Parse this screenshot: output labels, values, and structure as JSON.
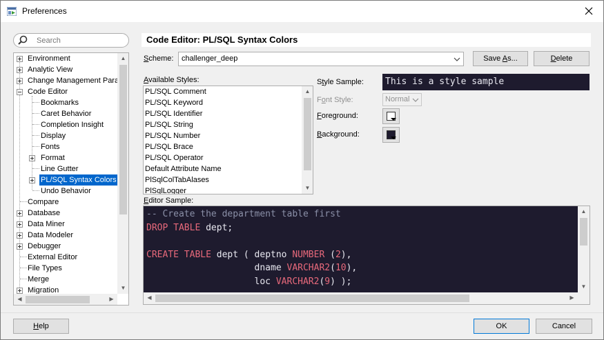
{
  "window": {
    "title": "Preferences"
  },
  "search": {
    "placeholder": "Search"
  },
  "tree": {
    "items": [
      {
        "label": "Environment"
      },
      {
        "label": "Analytic View"
      },
      {
        "label": "Change Management Parar"
      },
      {
        "label": "Code Editor"
      },
      {
        "label": "Bookmarks"
      },
      {
        "label": "Caret Behavior"
      },
      {
        "label": "Completion Insight"
      },
      {
        "label": "Display"
      },
      {
        "label": "Fonts"
      },
      {
        "label": "Format"
      },
      {
        "label": "Line Gutter"
      },
      {
        "label": "PL/SQL Syntax Colors"
      },
      {
        "label": "Undo Behavior"
      },
      {
        "label": "Compare"
      },
      {
        "label": "Database"
      },
      {
        "label": "Data Miner"
      },
      {
        "label": "Data Modeler"
      },
      {
        "label": "Debugger"
      },
      {
        "label": "External Editor"
      },
      {
        "label": "File Types"
      },
      {
        "label": "Merge"
      },
      {
        "label": "Migration"
      }
    ]
  },
  "panel": {
    "title": "Code Editor: PL/SQL Syntax Colors",
    "scheme_label_pre": "",
    "scheme_label_u": "S",
    "scheme_label_post": "cheme:",
    "scheme_value": "challenger_deep",
    "save_as_pre": "Save ",
    "save_as_u": "A",
    "save_as_post": "s...",
    "delete_u": "D",
    "delete_post": "elete",
    "styles_label_u": "A",
    "styles_label_post": "vailable Styles:",
    "styles": [
      "PL/SQL Comment",
      "PL/SQL Keyword",
      "PL/SQL Identifier",
      "PL/SQL String",
      "PL/SQL Number",
      "PL/SQL Brace",
      "PL/SQL Operator",
      "Default Attribute Name",
      "PlSqlColTabAlases",
      "PlSqlLogger"
    ],
    "style_sample_label_pre": "S",
    "style_sample_label_u": "t",
    "style_sample_label_post": "yle Sample:",
    "style_sample_text": "This is a style sample",
    "font_style_label_pre": "F",
    "font_style_label_u": "o",
    "font_style_label_post": "nt Style:",
    "font_style_value": "Normal",
    "foreground_label_u": "F",
    "foreground_label_post": "oreground:",
    "background_label_u": "B",
    "background_label_post": "ackground:",
    "editor_sample_label_u": "E",
    "editor_sample_label_post": "ditor Sample:"
  },
  "editor_code": {
    "line1": "-- Create the department table first",
    "line2_kw": "DROP TABLE",
    "line2_rest": " dept;",
    "line4_kw": "CREATE TABLE",
    "line4_a": " dept ( deptno ",
    "line4_type": "NUMBER",
    "line4_b": " (",
    "line4_num": "2",
    "line4_c": "),",
    "line5_a": "                    dname ",
    "line5_type": "VARCHAR2",
    "line5_b": "(",
    "line5_num": "10",
    "line5_c": "),",
    "line6_a": "                    loc ",
    "line6_type": "VARCHAR2",
    "line6_b": "(",
    "line6_num": "9",
    "line6_c": ") );"
  },
  "footer": {
    "help_u": "H",
    "help_post": "elp",
    "ok_label": "OK",
    "cancel_label": "Cancel"
  },
  "colors": {
    "editor_bg": "#1e1b2e",
    "keyword": "#e8697b",
    "comment": "#8b90a8",
    "selection": "#0066cc"
  }
}
